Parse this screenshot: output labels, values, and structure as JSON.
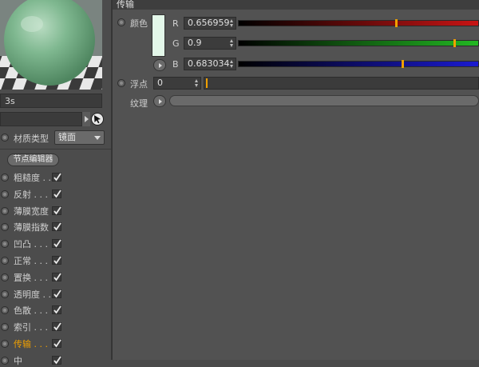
{
  "preview": {
    "time": "3s"
  },
  "material": {
    "type_label": "材质类型",
    "type_value": "镜面"
  },
  "node_editor_label": "节点编辑器",
  "channels": [
    {
      "label": "粗糙度 . .",
      "checked": true,
      "active": false
    },
    {
      "label": "反射 . . .",
      "checked": true,
      "active": false
    },
    {
      "label": "薄膜宽度",
      "checked": true,
      "active": false
    },
    {
      "label": "薄膜指数",
      "checked": true,
      "active": false
    },
    {
      "label": "凹凸 . . .",
      "checked": true,
      "active": false
    },
    {
      "label": "正常 . . .",
      "checked": true,
      "active": false
    },
    {
      "label": "置换 . . .",
      "checked": true,
      "active": false
    },
    {
      "label": "透明度 . .",
      "checked": true,
      "active": false
    },
    {
      "label": "色散 . . .",
      "checked": true,
      "active": false
    },
    {
      "label": "索引 . . .",
      "checked": true,
      "active": false
    },
    {
      "label": "传输 . . .",
      "checked": true,
      "active": true
    },
    {
      "label": "中",
      "checked": true,
      "active": false
    }
  ],
  "section": {
    "title": "传输"
  },
  "color": {
    "label": "颜色",
    "swatch": "#e3f7e9",
    "r": {
      "letter": "R",
      "value": "0.656959",
      "fraction": 0.656959
    },
    "g": {
      "letter": "G",
      "value": "0.9",
      "fraction": 0.9
    },
    "b": {
      "letter": "B",
      "value": "0.683034",
      "fraction": 0.683034
    }
  },
  "float": {
    "label": "浮点",
    "value": "0"
  },
  "texture": {
    "label": "纹理"
  },
  "colors": {
    "accent": "#f0a000",
    "red": "#c81414",
    "green": "#22b822",
    "blue": "#1a1ad0"
  }
}
